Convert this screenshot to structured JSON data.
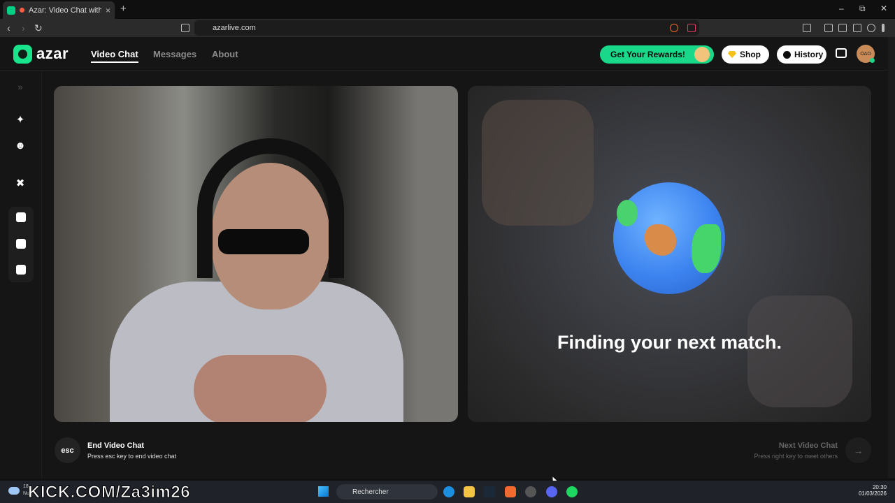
{
  "browser": {
    "tab_title": "Azar: Video Chat with New Pe",
    "tab_close": "×",
    "new_tab": "+",
    "url": "azarlive.com",
    "window_controls": {
      "minimize": "–",
      "maximize": "⧉",
      "close": "✕"
    },
    "nav": {
      "back": "‹",
      "forward": "›",
      "reload": "↻"
    }
  },
  "header": {
    "logo_text": "azar",
    "nav": [
      {
        "label": "Video Chat",
        "active": true
      },
      {
        "label": "Messages",
        "active": false
      },
      {
        "label": "About",
        "active": false
      }
    ],
    "rewards_label": "Get Your Rewards!",
    "shop_label": "Shop",
    "history_label": "History",
    "avatar_text": "OΔO"
  },
  "sidebar": {
    "expand_icon": "»",
    "items": [
      {
        "icon": "magic-wand-icon",
        "glyph": "✦"
      },
      {
        "icon": "face-filter-icon",
        "glyph": "☻"
      },
      {
        "icon": "sticker-icon",
        "glyph": "✖"
      }
    ],
    "layout_items": [
      {
        "icon": "layout-side-by-side-icon"
      },
      {
        "icon": "layout-stacked-icon"
      },
      {
        "icon": "layout-grid-icon"
      }
    ]
  },
  "match": {
    "status_text": "Finding your next match."
  },
  "controls": {
    "end": {
      "key": "esc",
      "title": "End Video Chat",
      "subtitle": "Press esc key to end video chat"
    },
    "next": {
      "title": "Next Video Chat",
      "subtitle": "Press right key to meet others",
      "arrow": "→"
    }
  },
  "taskbar": {
    "weather_temp": "18",
    "weather_label": "Nu",
    "overlay_text": "KICK.COM/Za3im26",
    "search_placeholder": "Rechercher",
    "time": "20:30",
    "date": "01/03/2026"
  },
  "colors": {
    "brand_green": "#19d88a",
    "shop_gem": "#f6c21a",
    "app_bg": "#151515"
  }
}
